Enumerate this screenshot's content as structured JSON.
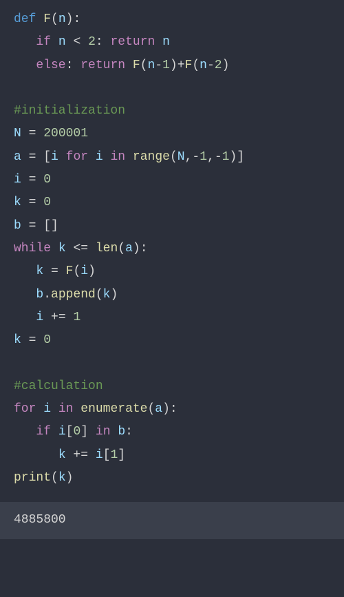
{
  "code": {
    "l1_def": "def",
    "l1_fn": "F",
    "l1_paren_o": "(",
    "l1_n": "n",
    "l1_paren_c": "):",
    "l2_if": "if",
    "l2_n": "n",
    "l2_lt": "<",
    "l2_2": "2",
    "l2_colon": ": ",
    "l2_return": "return",
    "l2_n2": "n",
    "l3_else": "else",
    "l3_colon": ": ",
    "l3_return": "return",
    "l3_fn": "F",
    "l3_po": "(",
    "l3_n1": "n",
    "l3_m1": "-",
    "l3_1": "1",
    "l3_pc": ")",
    "l3_plus": "+",
    "l3_fn2": "F",
    "l3_po2": "(",
    "l3_n2": "n",
    "l3_m2": "-",
    "l3_2": "2",
    "l3_pc2": ")",
    "l5_comment": "#initialization",
    "l6_N": "N",
    "l6_eq": " = ",
    "l6_val": "200001",
    "l7_a": "a",
    "l7_eq": " = ",
    "l7_bo": "[",
    "l7_i": "i",
    "l7_for": "for",
    "l7_i2": "i",
    "l7_in": "in",
    "l7_range": "range",
    "l7_po": "(",
    "l7_N": "N",
    "l7_c1": ",",
    "l7_m1": "-",
    "l7_1a": "1",
    "l7_c2": ",",
    "l7_m2": "-",
    "l7_1b": "1",
    "l7_pc": ")",
    "l7_bc": "]",
    "l8_i": "i",
    "l8_eq": " = ",
    "l8_0": "0",
    "l9_k": "k",
    "l9_eq": " = ",
    "l9_0": "0",
    "l10_b": "b",
    "l10_eq": " = ",
    "l10_br": "[]",
    "l11_while": "while",
    "l11_k": "k",
    "l11_le": "<=",
    "l11_len": "len",
    "l11_po": "(",
    "l11_a": "a",
    "l11_pc": "):",
    "l12_k": "k",
    "l12_eq": " = ",
    "l12_fn": "F",
    "l12_po": "(",
    "l12_i": "i",
    "l12_pc": ")",
    "l13_b": "b",
    "l13_dot": ".",
    "l13_append": "append",
    "l13_po": "(",
    "l13_k": "k",
    "l13_pc": ")",
    "l14_i": "i",
    "l14_pe": " += ",
    "l14_1": "1",
    "l15_k": "k",
    "l15_eq": " = ",
    "l15_0": "0",
    "l17_comment": "#calculation",
    "l18_for": "for",
    "l18_i": "i",
    "l18_in": "in",
    "l18_enum": "enumerate",
    "l18_po": "(",
    "l18_a": "a",
    "l18_pc": "):",
    "l19_if": "if",
    "l19_i": "i",
    "l19_bo": "[",
    "l19_0": "0",
    "l19_bc": "]",
    "l19_in": "in",
    "l19_b": "b",
    "l19_colon": ":",
    "l20_k": "k",
    "l20_pe": " += ",
    "l20_i": "i",
    "l20_bo": "[",
    "l20_1": "1",
    "l20_bc": "]",
    "l21_print": "print",
    "l21_po": "(",
    "l21_k": "k",
    "l21_pc": ")"
  },
  "output": "4885800"
}
